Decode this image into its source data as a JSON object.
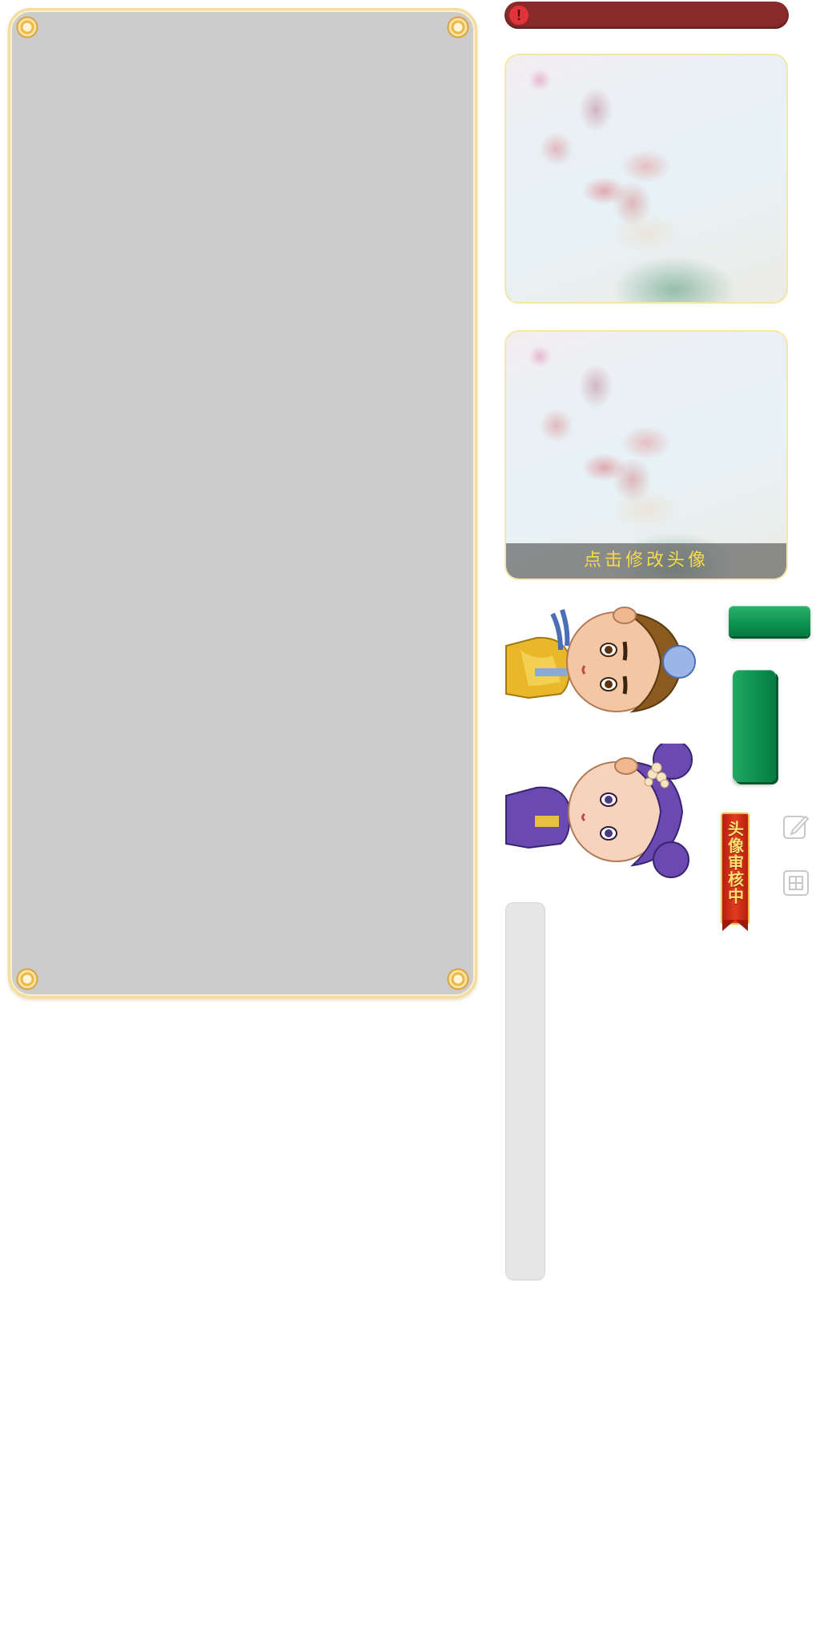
{
  "avatar_panel": {
    "change_avatar_caption": "点击修改头像"
  },
  "alert": {
    "icon": "exclamation-icon",
    "glyph": "!"
  },
  "review_ribbon": {
    "text": "头像审核中"
  },
  "icons": {
    "edit": "edit-icon",
    "grid": "grid-icon"
  },
  "colors": {
    "panel_bg": "#cccccc",
    "panel_border": "#f5dd9c",
    "alert_bar": "#8a2a2a",
    "alert_icon": "#e0333a",
    "caption_text": "#f7da4a",
    "button_green": "#0c9250",
    "ribbon_red": "#e03c20"
  }
}
